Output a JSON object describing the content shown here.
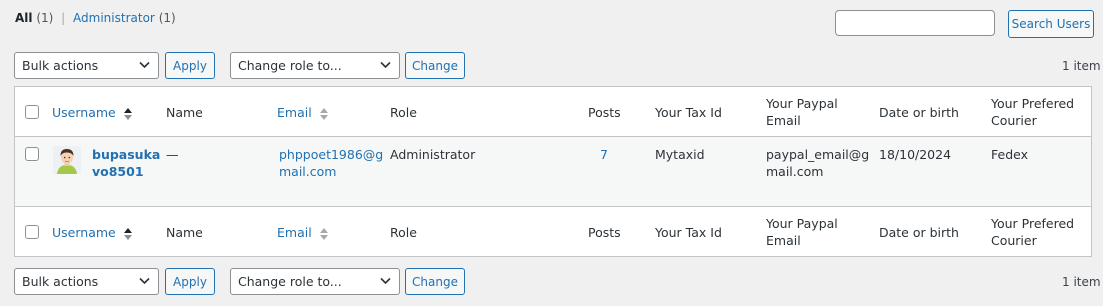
{
  "views": {
    "all_label": "All",
    "all_count": "(1)",
    "separator": "|",
    "admin_label": "Administrator",
    "admin_count": "(1)"
  },
  "search": {
    "button_label": "Search Users",
    "value": ""
  },
  "top_nav": {
    "bulk_actions": "Bulk actions",
    "apply": "Apply",
    "change_role": "Change role to...",
    "change": "Change",
    "items": "1 item"
  },
  "bottom_nav": {
    "bulk_actions": "Bulk actions",
    "apply": "Apply",
    "change_role": "Change role to...",
    "change": "Change",
    "items": "1 item"
  },
  "columns": {
    "username": "Username",
    "name": "Name",
    "email": "Email",
    "role": "Role",
    "posts": "Posts",
    "tax_id": "Your Tax Id",
    "paypal_line1": "Your Paypal",
    "paypal_line2": "Email",
    "dob": "Date or birth",
    "courier_line1": "Your Prefered",
    "courier_line2": "Courier"
  },
  "row": {
    "username_line1": "bupasuka",
    "username_line2": "vo8501",
    "name": "—",
    "email_line1": "phppoet1986@g",
    "email_line2": "mail.com",
    "role": "Administrator",
    "posts": "7",
    "tax_id": "Mytaxid",
    "paypal_line1": "paypal_email@g",
    "paypal_line2": "mail.com",
    "dob": "18/10/2024",
    "courier": "Fedex"
  }
}
